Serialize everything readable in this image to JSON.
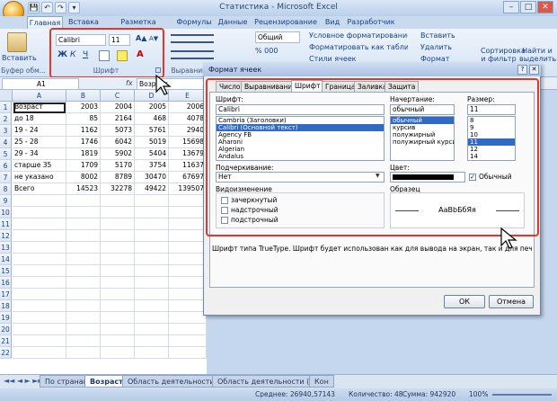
{
  "window": {
    "title": "Статистика - Microsoft Excel",
    "minimize": "–",
    "maximize": "□",
    "close": "✕"
  },
  "qat": [
    "💾",
    "↶",
    "↷",
    "▾"
  ],
  "tabs": [
    "Главная",
    "Вставка",
    "Разметка страницы",
    "Формулы",
    "Данные",
    "Рецензирование",
    "Вид",
    "Разработчик"
  ],
  "ribbon": {
    "clipboard": {
      "paste": "Вставить",
      "label": "Буфер обм..."
    },
    "font": {
      "name": "Calibri",
      "size": "11",
      "grow": "A▲",
      "shrink": "A▼",
      "bold": "Ж",
      "italic": "К",
      "underline": "Ч",
      "label": "Шрифт"
    },
    "alignment": {
      "label": "Выравнив"
    },
    "number": {
      "format": "Общий"
    },
    "styles": {
      "cond": "Условное форматирование",
      "table": "Форматировать как таблицу",
      "cell": "Стили ячеек"
    },
    "cells": {
      "insert": "Вставить",
      "delete": "Удалить",
      "format": "Формат"
    },
    "editing": {
      "sort": "Сортировка и фильтр",
      "find": "Найти и выделить"
    }
  },
  "formula": {
    "namebox": "A1",
    "fx": "fx",
    "content": "Возраст"
  },
  "columns": [
    "A",
    "B",
    "C",
    "D",
    "E"
  ],
  "rows": [
    [
      "Возраст",
      "2003",
      "2004",
      "2005",
      "2006"
    ],
    [
      "до 18",
      "85",
      "2164",
      "468",
      "4078"
    ],
    [
      "19 - 24",
      "1162",
      "5073",
      "5761",
      "2940"
    ],
    [
      "25 - 28",
      "1746",
      "6042",
      "5019",
      "15698"
    ],
    [
      "29 - 34",
      "1819",
      "5902",
      "5404",
      "13679"
    ],
    [
      "старше 35",
      "1709",
      "5170",
      "3754",
      "11637"
    ],
    [
      "не указано",
      "8002",
      "8789",
      "30470",
      "67697"
    ],
    [
      "Всего",
      "14523",
      "32278",
      "49422",
      "139507"
    ],
    [
      "",
      "",
      "",
      "",
      ""
    ],
    [
      "",
      "",
      "",
      "",
      ""
    ],
    [
      "",
      "",
      "",
      "",
      ""
    ],
    [
      "",
      "",
      "",
      "",
      ""
    ],
    [
      "",
      "",
      "",
      "",
      ""
    ],
    [
      "",
      "",
      "",
      "",
      ""
    ],
    [
      "",
      "",
      "",
      "",
      ""
    ],
    [
      "",
      "",
      "",
      "",
      ""
    ],
    [
      "",
      "",
      "",
      "",
      ""
    ],
    [
      "",
      "",
      "",
      "",
      ""
    ],
    [
      "",
      "",
      "",
      "",
      ""
    ],
    [
      "",
      "",
      "",
      "",
      ""
    ],
    [
      "",
      "",
      "",
      "",
      ""
    ],
    [
      "",
      "",
      "",
      "",
      ""
    ]
  ],
  "rownums": [
    "1",
    "2",
    "3",
    "4",
    "5",
    "6",
    "7",
    "8",
    "9",
    "10",
    "11",
    "12",
    "13",
    "14",
    "15",
    "16",
    "17",
    "18",
    "19",
    "20",
    "21",
    "22"
  ],
  "sheettabs": [
    "По странам",
    "Возраст",
    "Область деятельности",
    "Область деятельности (2)",
    "Кон"
  ],
  "status": {
    "avg": "Среднее: 26940,57143",
    "count": "Количество: 48",
    "sum": "Сумма: 942920",
    "zoom": "100%"
  },
  "dialog": {
    "title": "Формат ячеек",
    "help": "?",
    "close": "✕",
    "tabs": [
      "Число",
      "Выравнивание",
      "Шрифт",
      "Граница",
      "Заливка",
      "Защита"
    ],
    "font_label": "Шрифт:",
    "font_value": "Calibri",
    "fonts": [
      "Cambria (Заголовки)",
      "Calibri (Основной текст)",
      "Agency FB",
      "Aharoni",
      "Algerian",
      "Andalus"
    ],
    "style_label": "Начертание:",
    "style_value": "обычный",
    "styles": [
      "обычный",
      "курсив",
      "полужирный",
      "полужирный курсив"
    ],
    "size_label": "Размер:",
    "size_value": "11",
    "sizes": [
      "8",
      "9",
      "10",
      "11",
      "12",
      "14"
    ],
    "underline_label": "Подчеркивание:",
    "underline_value": "Нет",
    "color_label": "Цвет:",
    "normal_label": "Обычный",
    "effects_label": "Видоизменение",
    "effects": [
      "зачеркнутый",
      "надстрочный",
      "подстрочный"
    ],
    "sample_label": "Образец",
    "sample_text": "АаВbБбЯя",
    "info": "Шрифт типа TrueType. Шрифт будет использован как для вывода на экран, так и для печати.",
    "ok": "ОК",
    "cancel": "Отмена"
  }
}
